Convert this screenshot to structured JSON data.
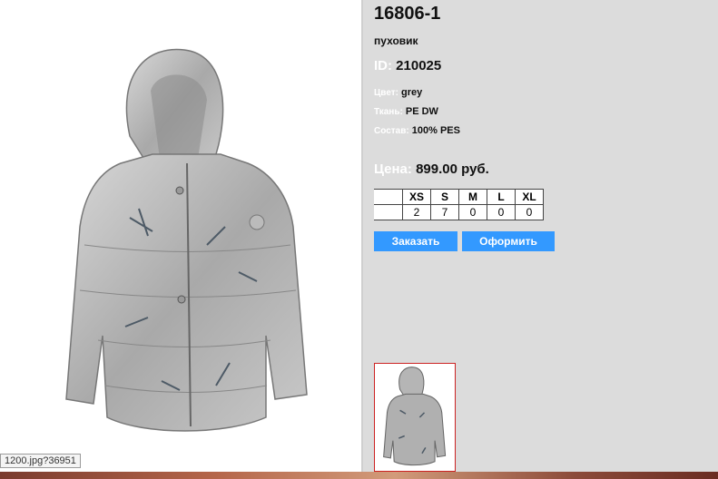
{
  "product": {
    "title": "16806-1",
    "type": "пуховик",
    "id_label": "ID:",
    "id_value": "210025",
    "attributes": [
      {
        "label": "Цвет:",
        "value": "grey"
      },
      {
        "label": "Ткань:",
        "value": "PE DW"
      },
      {
        "label": "Состав:",
        "value": "100% PES"
      }
    ],
    "price_label": "Цена:",
    "price_value": "899.00 руб."
  },
  "sizes": {
    "headers": [
      "XS",
      "S",
      "M",
      "L",
      "XL"
    ],
    "quantities": [
      "2",
      "7",
      "0",
      "0",
      "0"
    ]
  },
  "buttons": {
    "order_label": "Заказать",
    "checkout_label": "Оформить"
  },
  "status_tooltip": "1200.jpg?36951",
  "colors": {
    "panel_bg": "#dcdcdc",
    "button_bg": "#3399ff",
    "thumb_border": "#cc2222"
  }
}
